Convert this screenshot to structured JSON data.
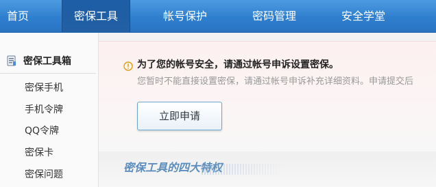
{
  "nav": {
    "tabs": [
      {
        "label": "首页"
      },
      {
        "label": "密保工具"
      },
      {
        "label": "帐号保护"
      },
      {
        "label": "密码管理"
      },
      {
        "label": "安全学堂"
      }
    ]
  },
  "sidebar": {
    "title": "密保工具箱",
    "items": [
      {
        "label": "密保手机"
      },
      {
        "label": "手机令牌"
      },
      {
        "label": "QQ令牌"
      },
      {
        "label": "密保卡"
      },
      {
        "label": "密保问题"
      }
    ]
  },
  "notice": {
    "headline": "为了您的帐号安全，请通过帐号申诉设置密保。",
    "description": "您暂时不能直接设置密保，请通过帐号申诉补充详细资料。申请提交后",
    "button_label": "立即申请",
    "icon": "warning-circle-icon",
    "accent_color": "#e39a1a"
  },
  "features": {
    "title": "密保工具的四大特权"
  },
  "colors": {
    "nav_bg": "#2f7fcf",
    "nav_active": "#1d5ea6",
    "features_title": "#5c8dbd"
  }
}
